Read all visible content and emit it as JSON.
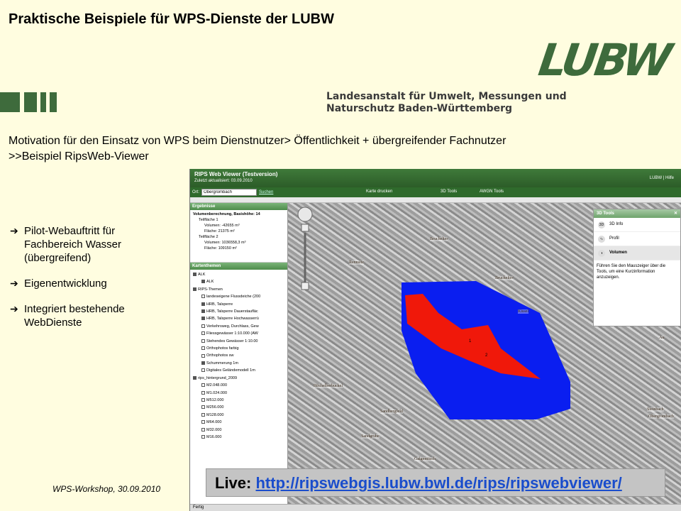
{
  "slide": {
    "title": "Praktische Beispiele für WPS-Dienste der LUBW",
    "logo_text": "LUBW",
    "agency_line1": "Landesanstalt für Umwelt, Messungen und",
    "agency_line2": "Naturschutz Baden-Württemberg",
    "motivation_line1": "Motivation für den Einsatz von WPS beim Dienstnutzer> Öffentlichkeit + übergreifender Fachnutzer",
    "motivation_line2": ">>Beispiel RipsWeb-Viewer",
    "bullets": [
      "Pilot-Webauftritt für Fachbereich Wasser (übergreifend)",
      "Eigenentwicklung",
      "Integriert bestehende WebDienste"
    ],
    "footer": "WPS-Workshop, 30.09.2010",
    "live_label": "Live:",
    "live_url": "http://ripswebgis.lubw.bwl.de/rips/ripswebviewer/"
  },
  "viewer": {
    "title": "RIPS Web Viewer (Testversion)",
    "updated": "Zuletzt aktualisiert: 03.09.2010",
    "header_right": "LUBW  |  Hilfe",
    "ort_label": "Ort:",
    "ort_value": "Obergrombach",
    "search_link": "Suchen",
    "menu": [
      "Karte drucken",
      "3D Tools",
      "AWGN Tools"
    ],
    "results_header": "Ergebnisse",
    "results": [
      "Volumenberechnung, Basishöhe: 14",
      "Teilfläche 1",
      "Volumen: -42655 m³",
      "Fläche: 21375 m²",
      "Teilfläche 2",
      "Volumen: 1036558,3 m³",
      "Fläche: 109150 m²"
    ],
    "layers_header": "Kartenthemen",
    "layers": [
      "ALK",
      "ALK",
      "RIPS-Themen",
      "landeseigene Flussdeiche (200",
      "HRB, Talsperre",
      "HRB, Talsperre Dauerstaufläc",
      "HRB, Talsperre Hochwasserrü",
      "Verkehrsweg, Durchlass, Gew",
      "Fliessgewässer 1:10.000 (AW",
      "Stehendes Gewässer 1:10.00",
      "Orthophotos farbig",
      "Orthophotos sw",
      "Schummerung 1m",
      "Digitales Geländemodell 1m",
      "rips_hintergrund_2009",
      "M2.048.000",
      "M1.024.000",
      "M512.000",
      "M256.000",
      "M128.000",
      "M64.000",
      "M32.000",
      "M16.000"
    ],
    "tools_popup_title": "3D Tools",
    "tools_items": [
      "3D Info",
      "Profil",
      "Volumen"
    ],
    "tools_help": "Führen Sie den Mauszeiger über die Tools, um eine Kurzinformation anzuzeigen.",
    "place_names": [
      "Bruchelter",
      "Rennsitz",
      "Bruchelter",
      "Kissel",
      "Höchelberbuckel",
      "Sandbergfeld",
      "Sandgrube",
      "Galgentösch",
      "Au",
      "Steinbach",
      "Obergrombach"
    ],
    "status": "Fertig",
    "colors": {
      "volume_outer": "#0a1ef0",
      "volume_inner": "#f0180a",
      "header_green": "#2f6a2c"
    }
  }
}
